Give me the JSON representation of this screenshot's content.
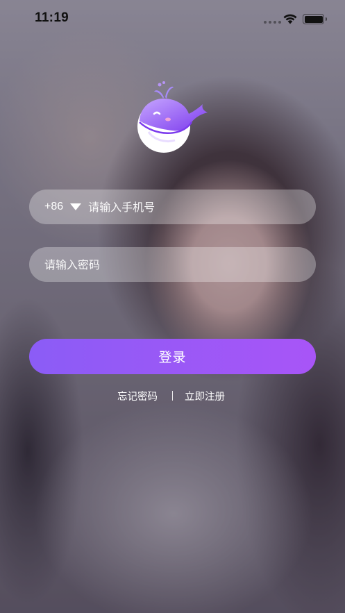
{
  "status_bar": {
    "time": "11:19",
    "icons": [
      "signal-dots",
      "wifi-icon",
      "battery-icon"
    ]
  },
  "logo": {
    "name": "whale-logo",
    "colors": [
      "#8b5cf6",
      "#b794f6",
      "#ffffff"
    ]
  },
  "phone_field": {
    "country_code": "+86",
    "placeholder": "请输入手机号",
    "value": ""
  },
  "password_field": {
    "placeholder": "请输入密码",
    "value": ""
  },
  "login_button": {
    "label": "登录",
    "gradient_start": "#8b5cf6",
    "gradient_end": "#a855f7"
  },
  "links": {
    "forgot_password": "忘记密码",
    "separator": "|",
    "register": "立即注册"
  }
}
